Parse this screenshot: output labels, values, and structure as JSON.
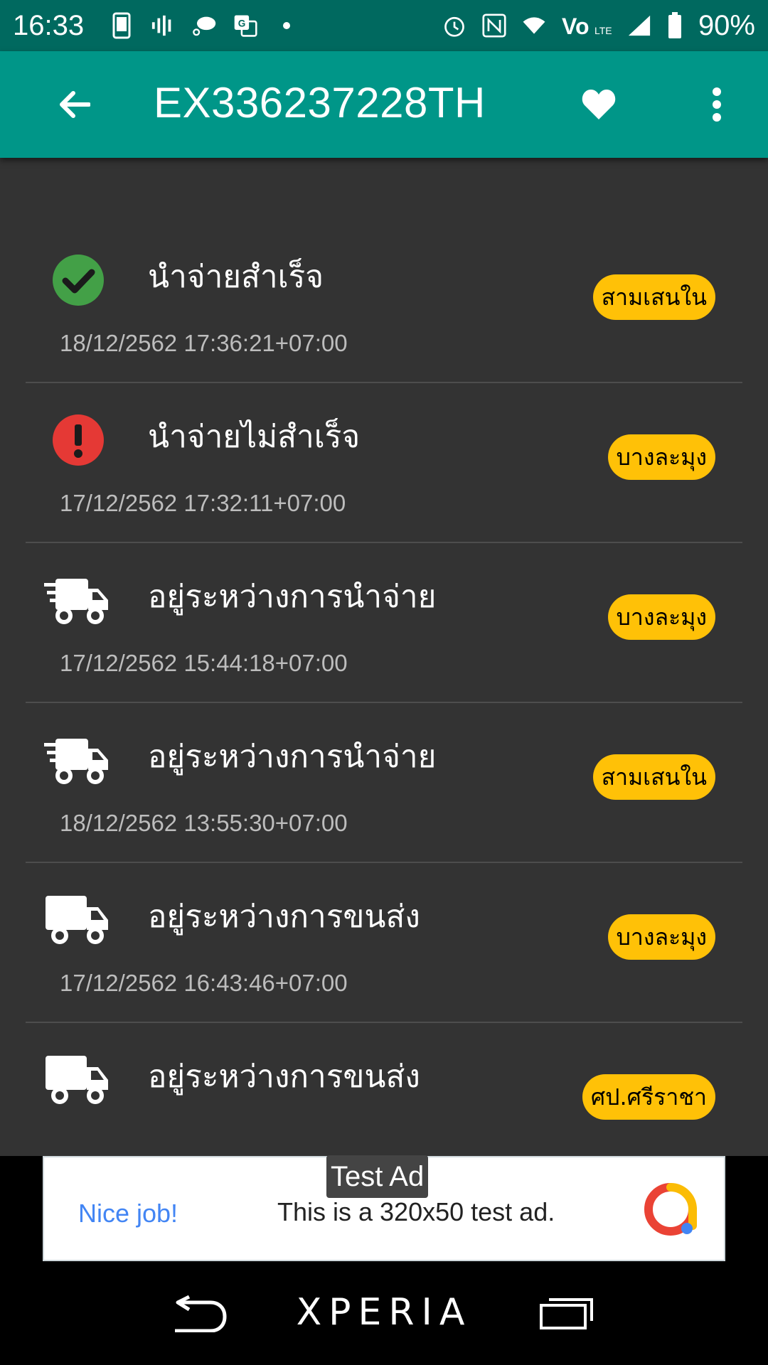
{
  "status_bar": {
    "time": "16:33",
    "battery": "90%"
  },
  "toolbar": {
    "title": "EX336237228TH",
    "icons": [
      "back-arrow-icon",
      "heart-icon",
      "more-vert-icon"
    ]
  },
  "tracking_items": [
    {
      "status": "นำจ่ายสำเร็จ",
      "timestamp": "18/12/2562 17:36:21+07:00",
      "location": "สามเสนใน",
      "icon": "check-circle-icon"
    },
    {
      "status": "นำจ่ายไม่สำเร็จ",
      "timestamp": "17/12/2562 17:32:11+07:00",
      "location": "บางละมุง",
      "icon": "error-icon"
    },
    {
      "status": "อยู่ระหว่างการนำจ่าย",
      "timestamp": "17/12/2562 15:44:18+07:00",
      "location": "บางละมุง",
      "icon": "fast-truck-icon"
    },
    {
      "status": "อยู่ระหว่างการนำจ่าย",
      "timestamp": "18/12/2562 13:55:30+07:00",
      "location": "สามเสนใน",
      "icon": "fast-truck-icon"
    },
    {
      "status": "อยู่ระหว่างการขนส่ง",
      "timestamp": "17/12/2562 16:43:46+07:00",
      "location": "บางละมุง",
      "icon": "truck-icon"
    },
    {
      "status": "อยู่ระหว่างการขนส่ง",
      "timestamp": "",
      "location": "ศป.ศรีราชา",
      "icon": "truck-icon"
    }
  ],
  "colors": {
    "status_bar": "#00695f",
    "toolbar": "#009688",
    "background": "#333333",
    "badge": "#ffc107",
    "success": "#43a047",
    "error": "#e53935"
  },
  "ad": {
    "label": "Test Ad",
    "nice": "Nice job!",
    "text": "This is a 320x50 test ad."
  },
  "nav": {
    "brand": "XPERIA"
  }
}
